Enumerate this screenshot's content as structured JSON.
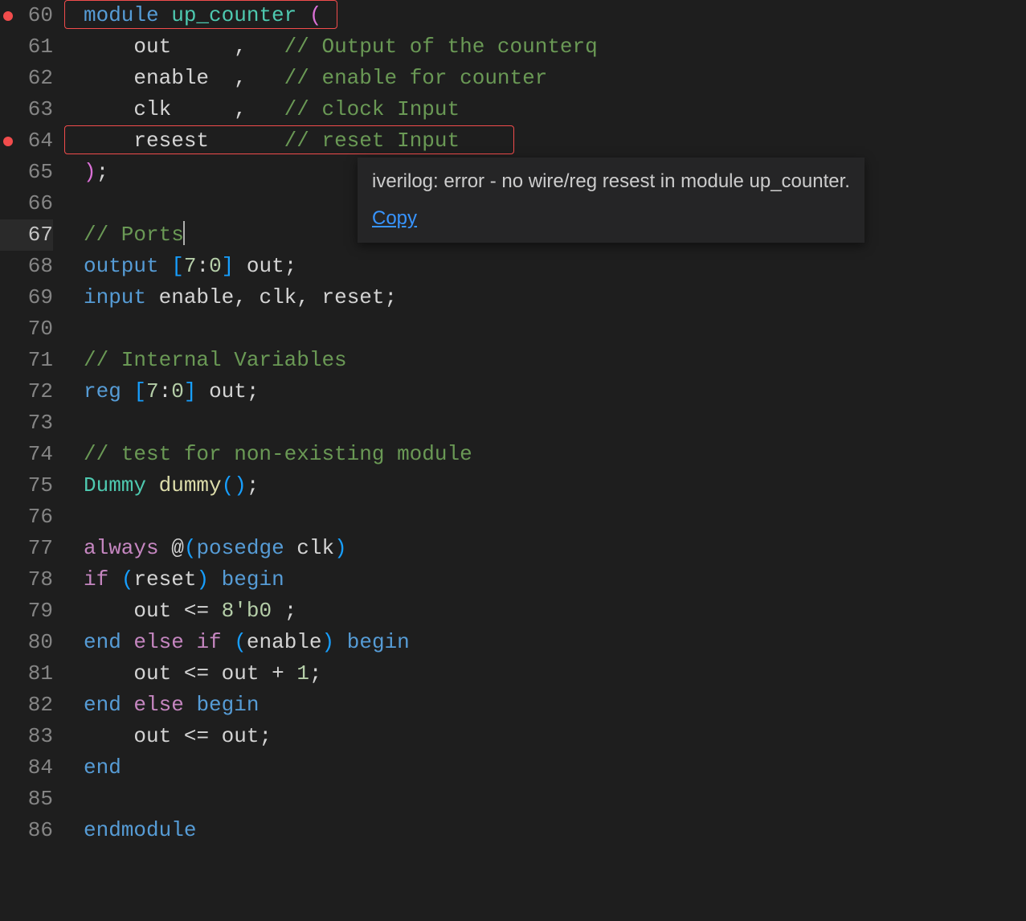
{
  "gutter": {
    "start": 60,
    "end": 86,
    "current": 67,
    "errors": [
      60,
      64
    ]
  },
  "tooltip": {
    "message": "iverilog: error - no wire/reg resest in module up_counter.",
    "link": "Copy"
  },
  "code": {
    "lines": [
      {
        "n": 60,
        "tokens": [
          [
            "kw",
            "module"
          ],
          [
            "",
            ""
          ],
          [
            "type",
            " up_counter "
          ],
          [
            "paren1",
            "("
          ]
        ],
        "err": 1
      },
      {
        "n": 61,
        "tokens": [
          [
            "",
            "    "
          ],
          [
            "ident",
            "out     "
          ],
          [
            "punct",
            ","
          ],
          [
            "",
            "   "
          ],
          [
            "comment",
            "// Output of the counterq"
          ]
        ]
      },
      {
        "n": 62,
        "tokens": [
          [
            "",
            "    "
          ],
          [
            "ident",
            "enable  "
          ],
          [
            "punct",
            ","
          ],
          [
            "",
            "   "
          ],
          [
            "comment",
            "// enable for counter"
          ]
        ]
      },
      {
        "n": 63,
        "tokens": [
          [
            "",
            "    "
          ],
          [
            "ident",
            "clk     "
          ],
          [
            "punct",
            ","
          ],
          [
            "",
            "   "
          ],
          [
            "comment",
            "// clock Input"
          ]
        ]
      },
      {
        "n": 64,
        "tokens": [
          [
            "",
            "    "
          ],
          [
            "ident",
            "resest      "
          ],
          [
            "comment",
            "// reset Input"
          ]
        ],
        "err": 2
      },
      {
        "n": 65,
        "tokens": [
          [
            "paren1",
            ")"
          ],
          [
            "punct",
            ";"
          ]
        ]
      },
      {
        "n": 66,
        "tokens": []
      },
      {
        "n": 67,
        "tokens": [
          [
            "comment",
            "// Ports"
          ]
        ],
        "cursor": true
      },
      {
        "n": 68,
        "tokens": [
          [
            "kw",
            "output"
          ],
          [
            "",
            " "
          ],
          [
            "bracket-yellow",
            "["
          ],
          [
            "num-lit",
            "7"
          ],
          [
            "punct",
            ":"
          ],
          [
            "num-lit",
            "0"
          ],
          [
            "bracket-yellow",
            "]"
          ],
          [
            "",
            " "
          ],
          [
            "ident",
            "out"
          ],
          [
            "punct",
            ";"
          ]
        ]
      },
      {
        "n": 69,
        "tokens": [
          [
            "kw",
            "input"
          ],
          [
            "",
            " "
          ],
          [
            "ident",
            "enable"
          ],
          [
            "punct",
            ","
          ],
          [
            "",
            " "
          ],
          [
            "ident",
            "clk"
          ],
          [
            "punct",
            ","
          ],
          [
            "",
            " "
          ],
          [
            "ident",
            "reset"
          ],
          [
            "punct",
            ";"
          ]
        ]
      },
      {
        "n": 70,
        "tokens": []
      },
      {
        "n": 71,
        "tokens": [
          [
            "comment",
            "// Internal Variables"
          ]
        ]
      },
      {
        "n": 72,
        "tokens": [
          [
            "kw",
            "reg"
          ],
          [
            "",
            " "
          ],
          [
            "bracket-yellow",
            "["
          ],
          [
            "num-lit",
            "7"
          ],
          [
            "punct",
            ":"
          ],
          [
            "num-lit",
            "0"
          ],
          [
            "bracket-yellow",
            "]"
          ],
          [
            "",
            " "
          ],
          [
            "ident",
            "out"
          ],
          [
            "punct",
            ";"
          ]
        ]
      },
      {
        "n": 73,
        "tokens": []
      },
      {
        "n": 74,
        "tokens": [
          [
            "comment",
            "// test for non-existing module"
          ]
        ]
      },
      {
        "n": 75,
        "tokens": [
          [
            "type",
            "Dummy"
          ],
          [
            "",
            " "
          ],
          [
            "func",
            "dummy"
          ],
          [
            "bracket-yellow",
            "("
          ],
          [
            "bracket-yellow",
            ")"
          ],
          [
            "punct",
            ";"
          ]
        ]
      },
      {
        "n": 76,
        "tokens": []
      },
      {
        "n": 77,
        "tokens": [
          [
            "always",
            "always"
          ],
          [
            "",
            " "
          ],
          [
            "punct",
            "@"
          ],
          [
            "bracket-yellow",
            "("
          ],
          [
            "kw",
            "posedge"
          ],
          [
            "",
            " "
          ],
          [
            "ident",
            "clk"
          ],
          [
            "bracket-yellow",
            ")"
          ]
        ]
      },
      {
        "n": 78,
        "tokens": [
          [
            "control",
            "if"
          ],
          [
            "",
            " "
          ],
          [
            "bracket-yellow",
            "("
          ],
          [
            "ident",
            "reset"
          ],
          [
            "bracket-yellow",
            ")"
          ],
          [
            "",
            " "
          ],
          [
            "kw",
            "begin"
          ]
        ]
      },
      {
        "n": 79,
        "tokens": [
          [
            "",
            "    "
          ],
          [
            "ident",
            "out"
          ],
          [
            "",
            " "
          ],
          [
            "punct",
            "<="
          ],
          [
            "",
            " "
          ],
          [
            "num-lit",
            "8'b0"
          ],
          [
            "",
            " "
          ],
          [
            "punct",
            ";"
          ]
        ]
      },
      {
        "n": 80,
        "tokens": [
          [
            "kw",
            "end"
          ],
          [
            "",
            " "
          ],
          [
            "control",
            "else"
          ],
          [
            "",
            " "
          ],
          [
            "control",
            "if"
          ],
          [
            "",
            " "
          ],
          [
            "bracket-yellow",
            "("
          ],
          [
            "ident",
            "enable"
          ],
          [
            "bracket-yellow",
            ")"
          ],
          [
            "",
            " "
          ],
          [
            "kw",
            "begin"
          ]
        ]
      },
      {
        "n": 81,
        "tokens": [
          [
            "",
            "    "
          ],
          [
            "ident",
            "out"
          ],
          [
            "",
            " "
          ],
          [
            "punct",
            "<="
          ],
          [
            "",
            " "
          ],
          [
            "ident",
            "out"
          ],
          [
            "",
            " "
          ],
          [
            "punct",
            "+"
          ],
          [
            "",
            " "
          ],
          [
            "num-lit",
            "1"
          ],
          [
            "punct",
            ";"
          ]
        ]
      },
      {
        "n": 82,
        "tokens": [
          [
            "kw",
            "end"
          ],
          [
            "",
            " "
          ],
          [
            "control",
            "else"
          ],
          [
            "",
            " "
          ],
          [
            "kw",
            "begin"
          ]
        ]
      },
      {
        "n": 83,
        "tokens": [
          [
            "",
            "    "
          ],
          [
            "ident",
            "out"
          ],
          [
            "",
            " "
          ],
          [
            "punct",
            "<="
          ],
          [
            "",
            " "
          ],
          [
            "ident",
            "out"
          ],
          [
            "punct",
            ";"
          ]
        ]
      },
      {
        "n": 84,
        "tokens": [
          [
            "kw",
            "end"
          ]
        ]
      },
      {
        "n": 85,
        "tokens": []
      },
      {
        "n": 86,
        "tokens": [
          [
            "kw",
            "endmodule"
          ]
        ]
      }
    ]
  }
}
